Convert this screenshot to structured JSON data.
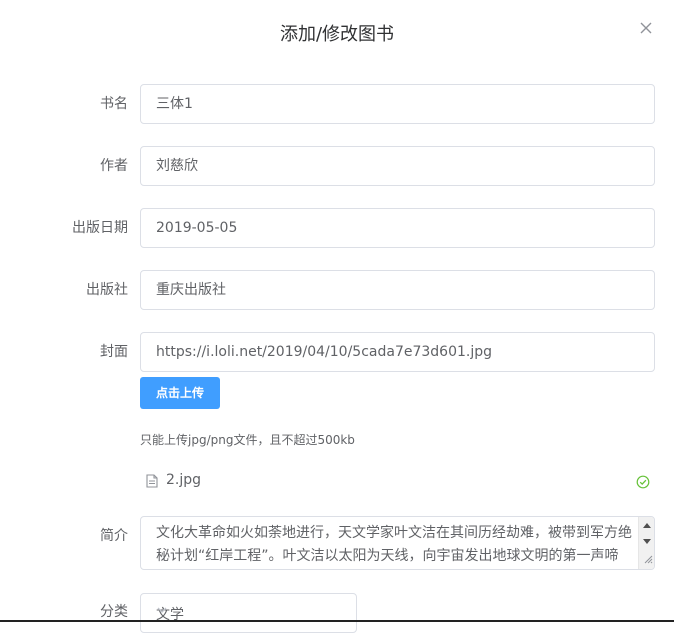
{
  "dialog": {
    "title": "添加/修改图书"
  },
  "form": {
    "name": {
      "label": "书名",
      "value": "三体1"
    },
    "author": {
      "label": "作者",
      "value": "刘慈欣"
    },
    "date": {
      "label": "出版日期",
      "value": "2019-05-05"
    },
    "press": {
      "label": "出版社",
      "value": "重庆出版社"
    },
    "cover": {
      "label": "封面",
      "value": "https://i.loli.net/2019/04/10/5cada7e73d601.jpg",
      "upload_label": "点击上传",
      "tip": "只能上传jpg/png文件，且不超过500kb",
      "file_name": "2.jpg"
    },
    "abs": {
      "label": "简介",
      "value": "文化大革命如火如荼地进行，天文学家叶文洁在其间历经劫难，被带到军方绝秘计划“红岸工程”。叶文洁以太阳为天线，向宇宙发出地球文明的第一声啼鸣，取得了探寻外星文明的突破性进展。三颗无规则运行的太阳主导下"
    },
    "category": {
      "label": "分类",
      "value": "文学"
    }
  },
  "icons": {
    "close": "close-icon",
    "file": "document-icon",
    "success": "check-circle-icon",
    "dropdown": "chevron-down-icon"
  },
  "colors": {
    "primary": "#409eff",
    "success": "#67c23a",
    "border": "#dcdfe6"
  }
}
